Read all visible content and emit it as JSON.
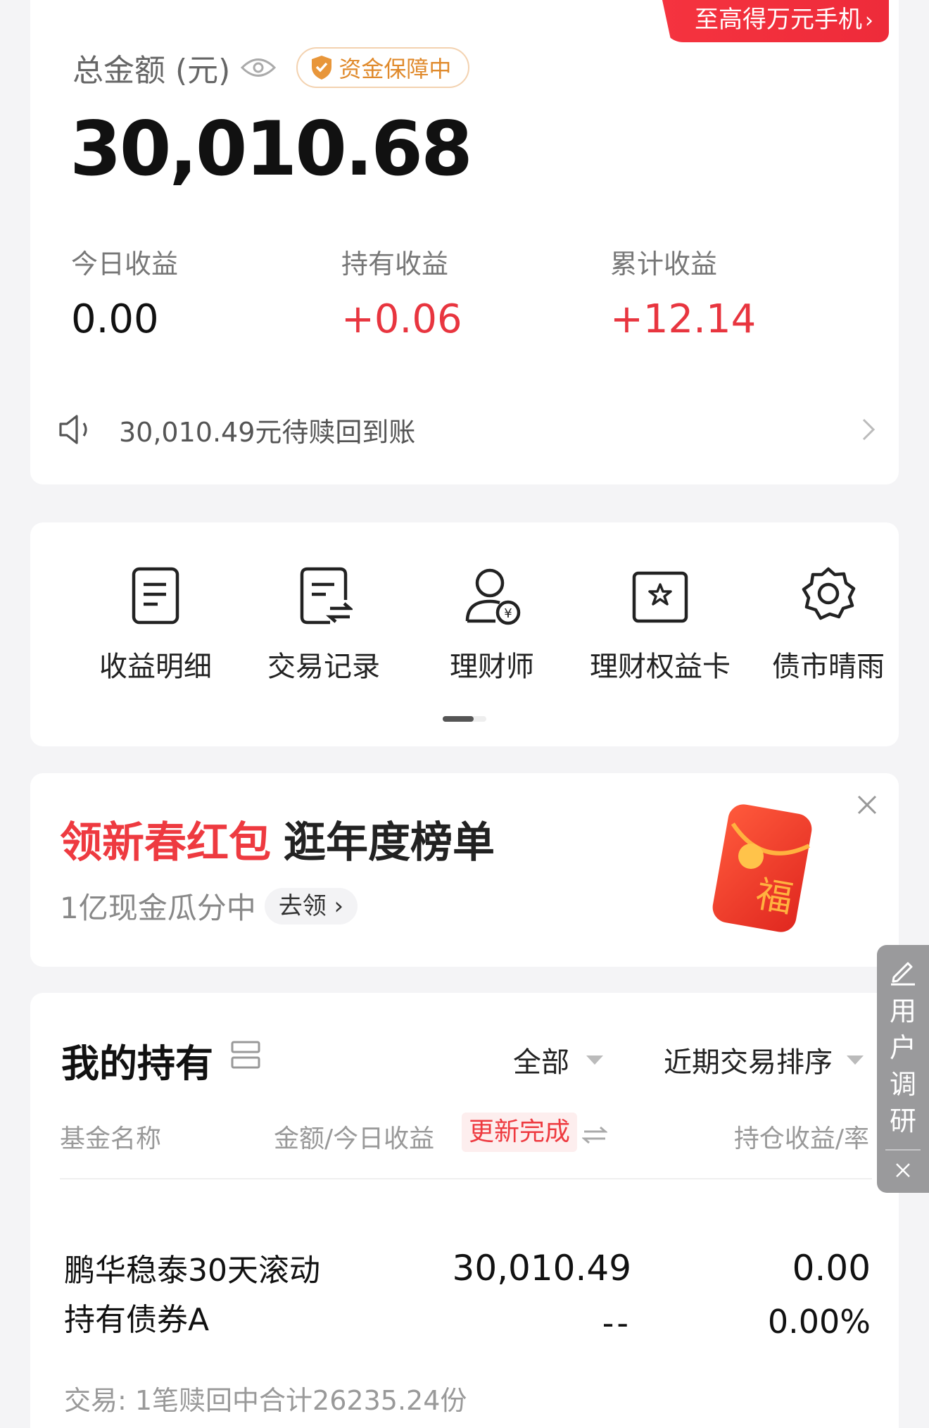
{
  "summary": {
    "promo": "至高得万元手机",
    "total_label": "总金额 (元)",
    "guard_badge": "资金保障中",
    "total_amount": "30,010.68",
    "stats": [
      {
        "label": "今日收益",
        "value": "0.00"
      },
      {
        "label": "持有收益",
        "value": "+0.06"
      },
      {
        "label": "累计收益",
        "value": "+12.14"
      }
    ],
    "notice": "30,010.49元待赎回到账"
  },
  "quick_entries": [
    {
      "label": "收益明细",
      "icon": "income-detail-icon"
    },
    {
      "label": "交易记录",
      "icon": "transaction-record-icon"
    },
    {
      "label": "理财师",
      "icon": "advisor-icon"
    },
    {
      "label": "理财权益卡",
      "icon": "benefit-card-icon"
    },
    {
      "label": "债市晴雨",
      "icon": "bond-market-icon"
    }
  ],
  "banner": {
    "title_highlight": "领新春红包",
    "title_rest": "逛年度榜单",
    "subtitle": "1亿现金瓜分中",
    "action": "去领",
    "packet_char": "福"
  },
  "holdings": {
    "title": "我的持有",
    "filter_all": "全部",
    "sort": "近期交易排序",
    "col_name": "基金名称",
    "col_amount": "金额/今日收益",
    "update_badge": "更新完成",
    "col_hold": "持仓收益/率",
    "fund": {
      "name_line1": "鹏华稳泰30天滚动",
      "name_line2": "持有债券A",
      "amount": "30,010.49",
      "today": "--",
      "hold_profit": "0.00",
      "hold_rate": "0.00%"
    },
    "trade_note": "交易: 1笔赎回中合计26235.24份"
  },
  "survey": {
    "chars": [
      "用",
      "户",
      "调",
      "研"
    ]
  },
  "colors": {
    "accent_red": "#ee3a40",
    "guard_orange": "#e08a2c"
  }
}
